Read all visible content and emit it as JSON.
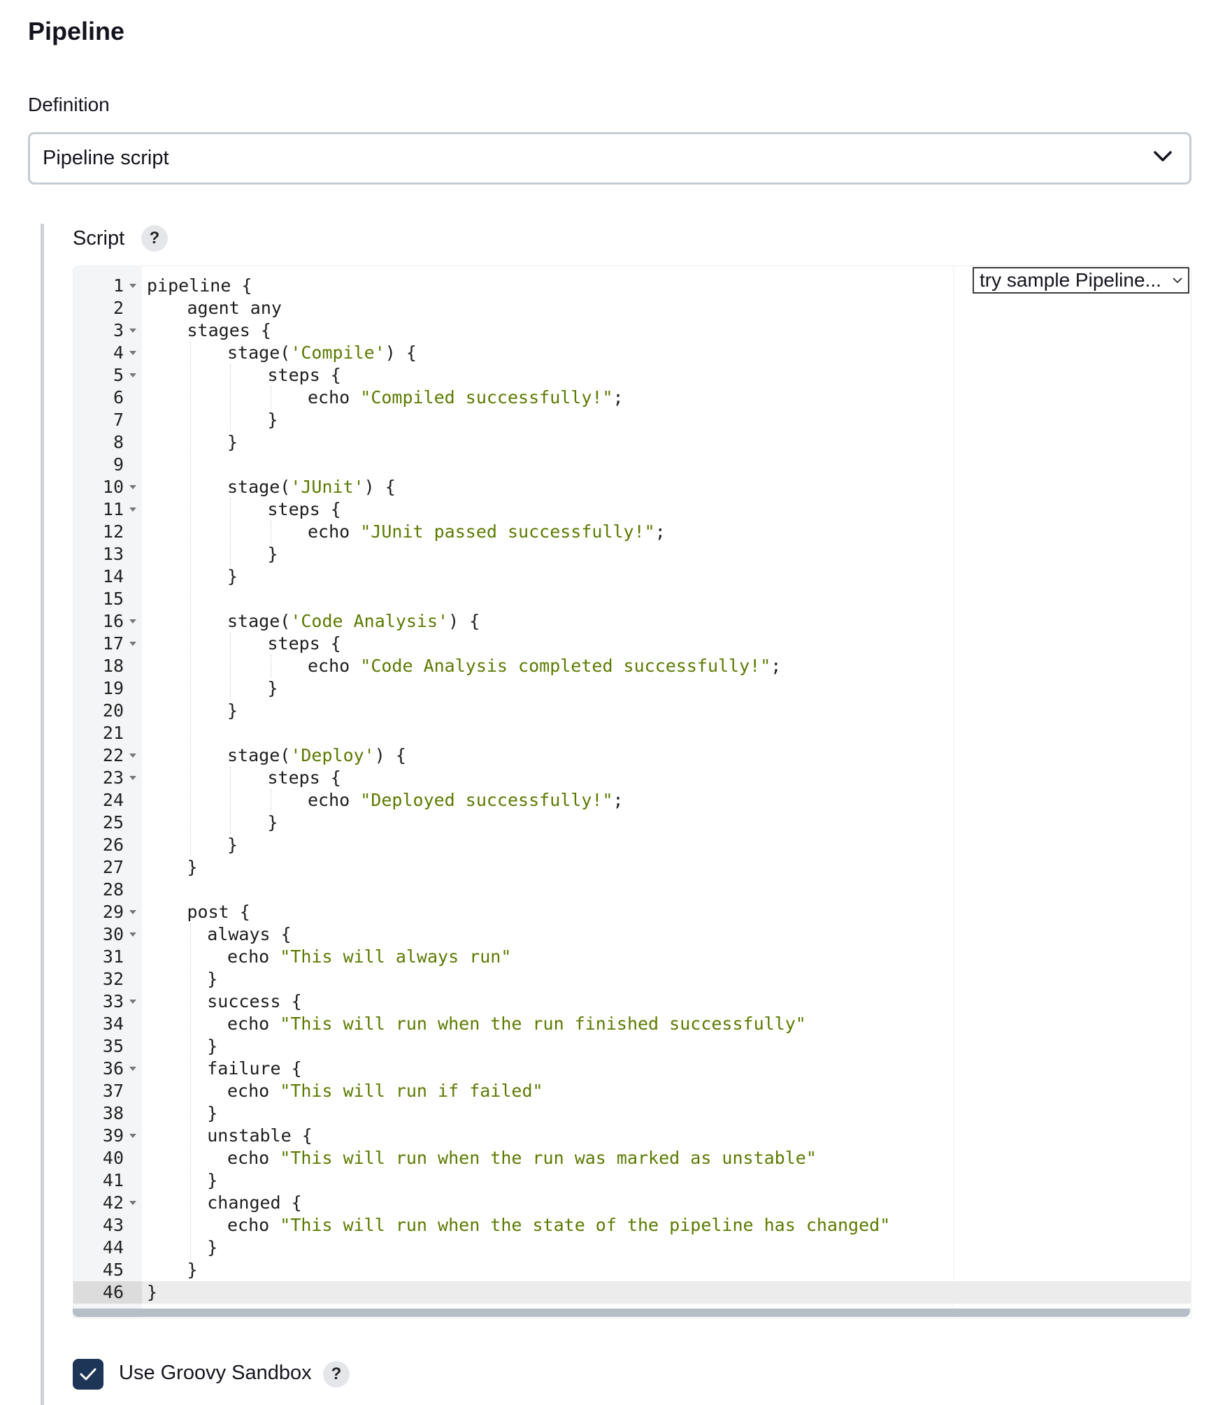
{
  "page": {
    "title": "Pipeline"
  },
  "definition": {
    "label": "Definition",
    "selected": "Pipeline script",
    "icon": "chevron-down-icon"
  },
  "script": {
    "label": "Script",
    "help": "?",
    "sample_select": "try sample Pipeline...",
    "active_line": 46,
    "lines": [
      {
        "n": "1",
        "fold": true,
        "indent": 0,
        "parts": [
          [
            "plain",
            "pipeline {"
          ]
        ]
      },
      {
        "n": "2",
        "fold": false,
        "indent": 1,
        "parts": [
          [
            "plain",
            "agent any"
          ]
        ]
      },
      {
        "n": "3",
        "fold": true,
        "indent": 1,
        "parts": [
          [
            "plain",
            "stages {"
          ]
        ]
      },
      {
        "n": "4",
        "fold": true,
        "indent": 2,
        "parts": [
          [
            "plain",
            "stage("
          ],
          [
            "str",
            "'Compile'"
          ],
          [
            "plain",
            ") {"
          ]
        ]
      },
      {
        "n": "5",
        "fold": true,
        "indent": 3,
        "parts": [
          [
            "plain",
            "steps {"
          ]
        ]
      },
      {
        "n": "6",
        "fold": false,
        "indent": 4,
        "parts": [
          [
            "plain",
            "echo "
          ],
          [
            "str",
            "\"Compiled successfully!\""
          ],
          [
            "plain",
            ";"
          ]
        ]
      },
      {
        "n": "7",
        "fold": false,
        "indent": 3,
        "parts": [
          [
            "plain",
            "}"
          ]
        ]
      },
      {
        "n": "8",
        "fold": false,
        "indent": 2,
        "parts": [
          [
            "plain",
            "}"
          ]
        ]
      },
      {
        "n": "9",
        "fold": false,
        "indent": 0,
        "parts": []
      },
      {
        "n": "10",
        "fold": true,
        "indent": 2,
        "parts": [
          [
            "plain",
            "stage("
          ],
          [
            "str",
            "'JUnit'"
          ],
          [
            "plain",
            ") {"
          ]
        ]
      },
      {
        "n": "11",
        "fold": true,
        "indent": 3,
        "parts": [
          [
            "plain",
            "steps {"
          ]
        ]
      },
      {
        "n": "12",
        "fold": false,
        "indent": 4,
        "parts": [
          [
            "plain",
            "echo "
          ],
          [
            "str",
            "\"JUnit passed successfully!\""
          ],
          [
            "plain",
            ";"
          ]
        ]
      },
      {
        "n": "13",
        "fold": false,
        "indent": 3,
        "parts": [
          [
            "plain",
            "}"
          ]
        ]
      },
      {
        "n": "14",
        "fold": false,
        "indent": 2,
        "parts": [
          [
            "plain",
            "}"
          ]
        ]
      },
      {
        "n": "15",
        "fold": false,
        "indent": 0,
        "parts": []
      },
      {
        "n": "16",
        "fold": true,
        "indent": 2,
        "parts": [
          [
            "plain",
            "stage("
          ],
          [
            "str",
            "'Code Analysis'"
          ],
          [
            "plain",
            ") {"
          ]
        ]
      },
      {
        "n": "17",
        "fold": true,
        "indent": 3,
        "parts": [
          [
            "plain",
            "steps {"
          ]
        ]
      },
      {
        "n": "18",
        "fold": false,
        "indent": 4,
        "parts": [
          [
            "plain",
            "echo "
          ],
          [
            "str",
            "\"Code Analysis completed successfully!\""
          ],
          [
            "plain",
            ";"
          ]
        ]
      },
      {
        "n": "19",
        "fold": false,
        "indent": 3,
        "parts": [
          [
            "plain",
            "}"
          ]
        ]
      },
      {
        "n": "20",
        "fold": false,
        "indent": 2,
        "parts": [
          [
            "plain",
            "}"
          ]
        ]
      },
      {
        "n": "21",
        "fold": false,
        "indent": 0,
        "parts": []
      },
      {
        "n": "22",
        "fold": true,
        "indent": 2,
        "parts": [
          [
            "plain",
            "stage("
          ],
          [
            "str",
            "'Deploy'"
          ],
          [
            "plain",
            ") {"
          ]
        ]
      },
      {
        "n": "23",
        "fold": true,
        "indent": 3,
        "parts": [
          [
            "plain",
            "steps {"
          ]
        ]
      },
      {
        "n": "24",
        "fold": false,
        "indent": 4,
        "parts": [
          [
            "plain",
            "echo "
          ],
          [
            "str",
            "\"Deployed successfully!\""
          ],
          [
            "plain",
            ";"
          ]
        ]
      },
      {
        "n": "25",
        "fold": false,
        "indent": 3,
        "parts": [
          [
            "plain",
            "}"
          ]
        ]
      },
      {
        "n": "26",
        "fold": false,
        "indent": 2,
        "parts": [
          [
            "plain",
            "}"
          ]
        ]
      },
      {
        "n": "27",
        "fold": false,
        "indent": 1,
        "parts": [
          [
            "plain",
            "}"
          ]
        ]
      },
      {
        "n": "28",
        "fold": false,
        "indent": 0,
        "parts": []
      },
      {
        "n": "29",
        "fold": true,
        "indent": 1,
        "parts": [
          [
            "plain",
            "post {"
          ]
        ]
      },
      {
        "n": "30",
        "fold": true,
        "indent": 1.5,
        "parts": [
          [
            "plain",
            "always {"
          ]
        ]
      },
      {
        "n": "31",
        "fold": false,
        "indent": 2,
        "parts": [
          [
            "plain",
            "echo "
          ],
          [
            "str",
            "\"This will always run\""
          ]
        ]
      },
      {
        "n": "32",
        "fold": false,
        "indent": 1.5,
        "parts": [
          [
            "plain",
            "}"
          ]
        ]
      },
      {
        "n": "33",
        "fold": true,
        "indent": 1.5,
        "parts": [
          [
            "plain",
            "success {"
          ]
        ]
      },
      {
        "n": "34",
        "fold": false,
        "indent": 2,
        "parts": [
          [
            "plain",
            "echo "
          ],
          [
            "str",
            "\"This will run when the run finished successfully\""
          ]
        ]
      },
      {
        "n": "35",
        "fold": false,
        "indent": 1.5,
        "parts": [
          [
            "plain",
            "}"
          ]
        ]
      },
      {
        "n": "36",
        "fold": true,
        "indent": 1.5,
        "parts": [
          [
            "plain",
            "failure {"
          ]
        ]
      },
      {
        "n": "37",
        "fold": false,
        "indent": 2,
        "parts": [
          [
            "plain",
            "echo "
          ],
          [
            "str",
            "\"This will run if failed\""
          ]
        ]
      },
      {
        "n": "38",
        "fold": false,
        "indent": 1.5,
        "parts": [
          [
            "plain",
            "}"
          ]
        ]
      },
      {
        "n": "39",
        "fold": true,
        "indent": 1.5,
        "parts": [
          [
            "plain",
            "unstable {"
          ]
        ]
      },
      {
        "n": "40",
        "fold": false,
        "indent": 2,
        "parts": [
          [
            "plain",
            "echo "
          ],
          [
            "str",
            "\"This will run when the run was marked as unstable\""
          ]
        ]
      },
      {
        "n": "41",
        "fold": false,
        "indent": 1.5,
        "parts": [
          [
            "plain",
            "}"
          ]
        ]
      },
      {
        "n": "42",
        "fold": true,
        "indent": 1.5,
        "parts": [
          [
            "plain",
            "changed {"
          ]
        ]
      },
      {
        "n": "43",
        "fold": false,
        "indent": 2,
        "parts": [
          [
            "plain",
            "echo "
          ],
          [
            "str",
            "\"This will run when the state of the pipeline has changed\""
          ]
        ]
      },
      {
        "n": "44",
        "fold": false,
        "indent": 1.5,
        "parts": [
          [
            "plain",
            "}"
          ]
        ]
      },
      {
        "n": "45",
        "fold": false,
        "indent": 1,
        "parts": [
          [
            "plain",
            "}"
          ]
        ]
      },
      {
        "n": "46",
        "fold": false,
        "indent": 0,
        "parts": [
          [
            "plain",
            "}"
          ]
        ]
      }
    ]
  },
  "sandbox": {
    "label": "Use Groovy Sandbox",
    "checked": true,
    "help": "?"
  },
  "colors": {
    "string": "#5b7b00",
    "checkbox": "#1d3557"
  }
}
